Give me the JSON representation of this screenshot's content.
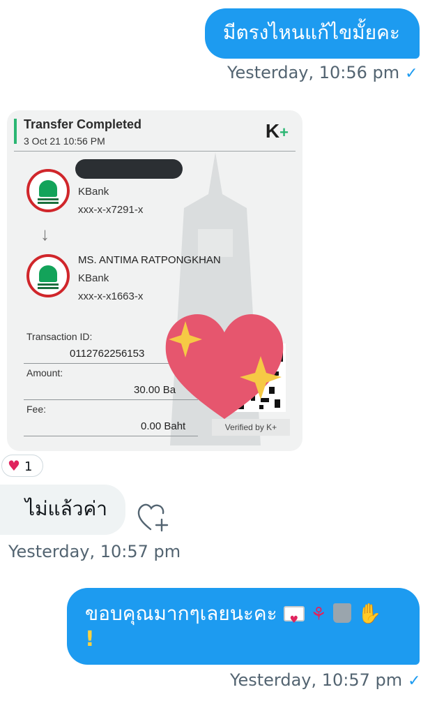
{
  "messages": {
    "msg1": {
      "text": "มีตรงไหนแก้ไขมั้ยคะ",
      "time": "Yesterday, 10:56 pm"
    },
    "msg2": {
      "text": "ไม่แล้วค่า",
      "time": "Yesterday, 10:57 pm"
    },
    "msg3": {
      "text": "ขอบคุณมากๆเลยนะคะ",
      "time": "Yesterday, 10:57 pm",
      "emojis": [
        "love-letter",
        "tulip",
        "wastebasket",
        "raised-hand",
        "exclamation"
      ],
      "exclamation": "!"
    }
  },
  "receipt": {
    "title": "Transfer Completed",
    "date": "3 Oct 21  10:56 PM",
    "logo_k": "K",
    "logo_plus": "+",
    "sender": {
      "bank": "KBank",
      "account": "xxx-x-x7291-x"
    },
    "recipient": {
      "name": "MS. ANTIMA RATPONGKHAN",
      "bank": "KBank",
      "account": "xxx-x-x1663-x"
    },
    "transaction_label": "Transaction ID:",
    "transaction_id": "0112762256153",
    "amount_label": "Amount:",
    "amount": "30.00 Ba",
    "fee_label": "Fee:",
    "fee": "0.00 Baht",
    "verified": "Verified by K+"
  },
  "reaction": {
    "emoji": "♥",
    "count": "1"
  },
  "colors": {
    "outgoing": "#1d9bf0",
    "incoming": "#eff3f4",
    "meta": "#536471",
    "kbank_green": "#2bb673",
    "kbank_red": "#d0262b"
  },
  "icons": {
    "read": "check-icon",
    "add_reaction": "heart-plus-icon",
    "sticker": "sparkling-heart-icon"
  }
}
